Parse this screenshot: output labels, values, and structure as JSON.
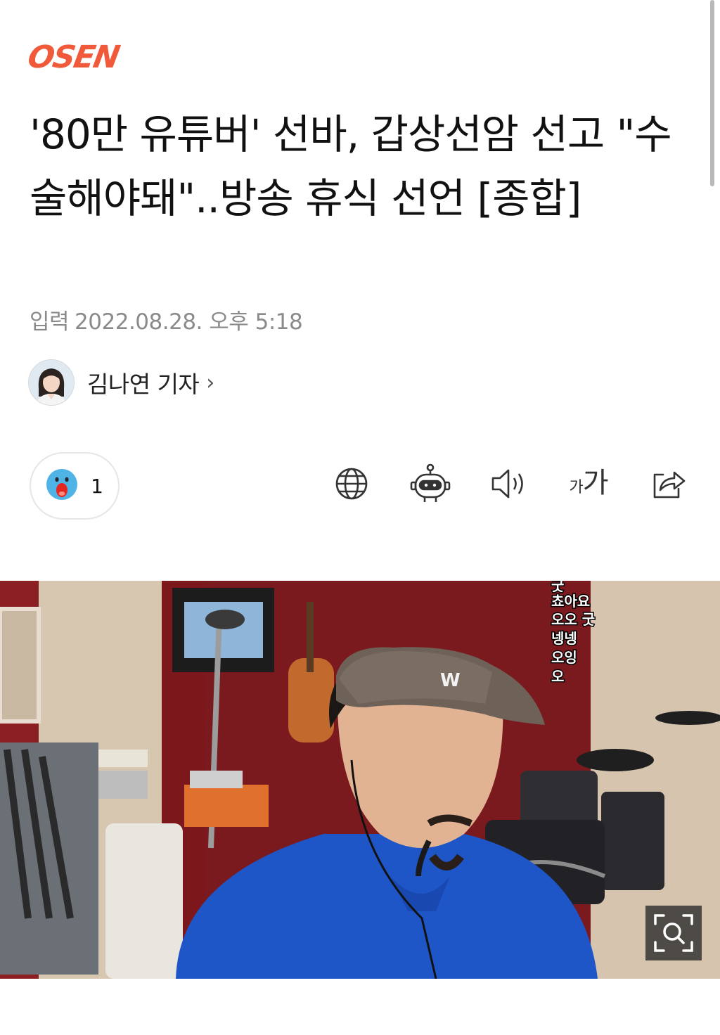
{
  "brand": {
    "logo_text": "OSEN",
    "accent_color": "#f05a3a"
  },
  "article": {
    "title": "'80만 유튜버' 선바, 갑상선암 선고 \"수술해야돼\"..방송 휴식 선언 [종합]",
    "published_label": "입력",
    "published_at": "2022.08.28. 오후 5:18"
  },
  "reporter": {
    "name": "김나연 기자",
    "chevron": "›"
  },
  "reaction": {
    "icon": "surprised-face-icon",
    "count": "1"
  },
  "toolbar": [
    {
      "icon": "globe-icon"
    },
    {
      "icon": "robot-icon"
    },
    {
      "icon": "speaker-icon"
    },
    {
      "icon": "font-size-icon",
      "label_small": "가",
      "label_large": "가"
    },
    {
      "icon": "share-icon"
    }
  ],
  "photo": {
    "chat_lines": [
      "굿",
      "쵸아요",
      "오오 굿",
      "넹넹",
      "오잉",
      "오"
    ],
    "cap_logo": "W",
    "zoom_icon": "zoom-icon"
  }
}
